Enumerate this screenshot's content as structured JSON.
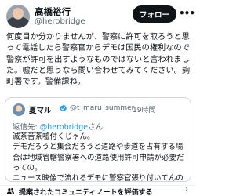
{
  "colors": {
    "text": "#0f1419",
    "secondary": "#536471",
    "link": "#1d9bf0",
    "verified": "#1d9bf0",
    "follow_bg": "#0f1419"
  },
  "post": {
    "author": {
      "name": "高橋裕行",
      "handle": "@herobridge",
      "avatar_icon": "avatar"
    },
    "follow_label": "フォロー",
    "more_icon": "more-icon",
    "text": "何度目か分かりませんが、警察に許可を取ろうと思って電話したら警察官からデモは国民の権利なので警察が許可を出すようなものではないと言われました。嘘だと思うなら問い合わせてみてください。麹町署です。警備課ね。"
  },
  "quote": {
    "author": {
      "name": "夏マル",
      "handle": "@t_maru_summer",
      "verified": true
    },
    "time": "19時間",
    "reply_prefix": "返信先: ",
    "reply_to": "@herobridge",
    "reply_suffix": "さん",
    "text": "滅茶苦茶嘘付くじゃん。\nデモだろうと集会だろうと道路や歩道を占有する場合は地域管轄警察署への道路使用許可申請が必要だっての。\nニュース映像で流れるデモに警察官張り付いてんの見..."
  },
  "community_note": {
    "label": "提案されたコミュニティノートを評価する",
    "icon": "people-icon"
  }
}
